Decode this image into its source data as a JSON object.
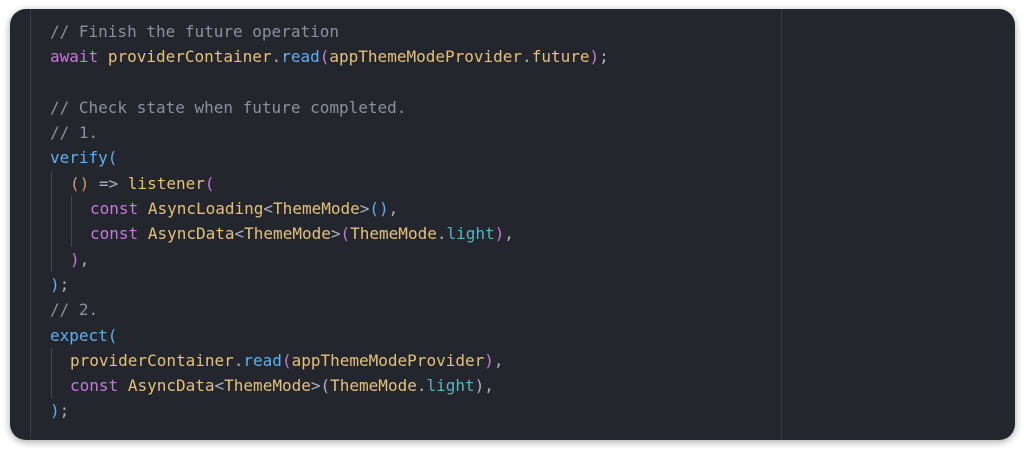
{
  "editor": {
    "lines": [
      {
        "indent": 0,
        "tokens": [
          {
            "t": "// Finish the future operation",
            "c": "cm"
          }
        ]
      },
      {
        "indent": 0,
        "tokens": [
          {
            "t": "await",
            "c": "kw"
          },
          {
            "t": " ",
            "c": "pn"
          },
          {
            "t": "providerContainer",
            "c": "id"
          },
          {
            "t": ".",
            "c": "pn"
          },
          {
            "t": "read",
            "c": "fn"
          },
          {
            "t": "(",
            "c": "bp"
          },
          {
            "t": "appThemeModeProvider",
            "c": "id"
          },
          {
            "t": ".",
            "c": "pn"
          },
          {
            "t": "future",
            "c": "id"
          },
          {
            "t": ")",
            "c": "bp"
          },
          {
            "t": ";",
            "c": "pn"
          }
        ]
      },
      {
        "indent": 0,
        "tokens": []
      },
      {
        "indent": 0,
        "tokens": [
          {
            "t": "// Check state when future completed.",
            "c": "cm"
          }
        ]
      },
      {
        "indent": 0,
        "tokens": [
          {
            "t": "// 1.",
            "c": "cm"
          }
        ]
      },
      {
        "indent": 0,
        "tokens": [
          {
            "t": "verify",
            "c": "fn"
          },
          {
            "t": "(",
            "c": "bb"
          }
        ]
      },
      {
        "indent": 1,
        "tokens": [
          {
            "t": "()",
            "c": "br"
          },
          {
            "t": " => ",
            "c": "pn"
          },
          {
            "t": "listener",
            "c": "id"
          },
          {
            "t": "(",
            "c": "bp"
          }
        ]
      },
      {
        "indent": 2,
        "tokens": [
          {
            "t": "const",
            "c": "kw"
          },
          {
            "t": " ",
            "c": "pn"
          },
          {
            "t": "AsyncLoading",
            "c": "id"
          },
          {
            "t": "<",
            "c": "pn"
          },
          {
            "t": "ThemeMode",
            "c": "id"
          },
          {
            "t": ">",
            "c": "pn"
          },
          {
            "t": "()",
            "c": "bb"
          },
          {
            "t": ",",
            "c": "pn"
          }
        ]
      },
      {
        "indent": 2,
        "tokens": [
          {
            "t": "const",
            "c": "kw"
          },
          {
            "t": " ",
            "c": "pn"
          },
          {
            "t": "AsyncData",
            "c": "id"
          },
          {
            "t": "<",
            "c": "pn"
          },
          {
            "t": "ThemeMode",
            "c": "id"
          },
          {
            "t": ">",
            "c": "pn"
          },
          {
            "t": "(",
            "c": "bp"
          },
          {
            "t": "ThemeMode",
            "c": "id"
          },
          {
            "t": ".",
            "c": "pn"
          },
          {
            "t": "light",
            "c": "pr"
          },
          {
            "t": ")",
            "c": "bp"
          },
          {
            "t": ",",
            "c": "pn"
          }
        ]
      },
      {
        "indent": 1,
        "tokens": [
          {
            "t": ")",
            "c": "bp"
          },
          {
            "t": ",",
            "c": "pn"
          }
        ]
      },
      {
        "indent": 0,
        "tokens": [
          {
            "t": ")",
            "c": "bb"
          },
          {
            "t": ";",
            "c": "pn"
          }
        ]
      },
      {
        "indent": 0,
        "tokens": [
          {
            "t": "// 2.",
            "c": "cm"
          }
        ]
      },
      {
        "indent": 0,
        "tokens": [
          {
            "t": "expect",
            "c": "fn"
          },
          {
            "t": "(",
            "c": "bb"
          }
        ]
      },
      {
        "indent": 1,
        "tokens": [
          {
            "t": "providerContainer",
            "c": "id"
          },
          {
            "t": ".",
            "c": "pn"
          },
          {
            "t": "read",
            "c": "fn"
          },
          {
            "t": "(",
            "c": "bp"
          },
          {
            "t": "appThemeModeProvider",
            "c": "id"
          },
          {
            "t": ")",
            "c": "bp"
          },
          {
            "t": ",",
            "c": "pn"
          }
        ]
      },
      {
        "indent": 1,
        "tokens": [
          {
            "t": "const",
            "c": "kw"
          },
          {
            "t": " ",
            "c": "pn"
          },
          {
            "t": "AsyncData",
            "c": "id"
          },
          {
            "t": "<",
            "c": "pn"
          },
          {
            "t": "ThemeMode",
            "c": "id"
          },
          {
            "t": ">",
            "c": "pn"
          },
          {
            "t": "(",
            "c": "pn"
          },
          {
            "t": "ThemeMode",
            "c": "id"
          },
          {
            "t": ".",
            "c": "pn"
          },
          {
            "t": "light",
            "c": "pr"
          },
          {
            "t": ")",
            "c": "pn"
          },
          {
            "t": ",",
            "c": "pn"
          }
        ]
      },
      {
        "indent": 0,
        "tokens": [
          {
            "t": ")",
            "c": "bb"
          },
          {
            "t": ";",
            "c": "pn"
          }
        ]
      }
    ]
  }
}
